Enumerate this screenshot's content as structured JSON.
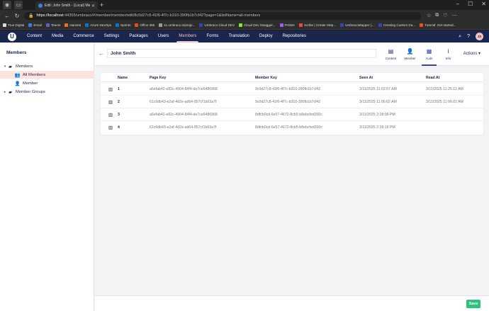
{
  "browser": {
    "tab_title": "Edit: John Smith - (Local) Member...",
    "new_tab": "+",
    "url_host": "https://localhost",
    "url_rest": ":44355/umbraco/#/member/member/edit/8c0d27c8-41f6-4f7c-b310-390fb1b7cf42?page=1&listName=all-members",
    "bookmarks": [
      {
        "label": "True Digital",
        "color": "#d9d9d9"
      },
      {
        "label": "Email",
        "color": "#3b7ddd"
      },
      {
        "label": "Teams",
        "color": "#5b5fc7"
      },
      {
        "label": "Harvest",
        "color": "#f36c21"
      },
      {
        "label": "Azure DevOps",
        "color": "#0078d4"
      },
      {
        "label": "Sprints",
        "color": "#0078d4"
      },
      {
        "label": "Office 365",
        "color": "#e74c1c"
      },
      {
        "label": "s1.umbraco.io/proje...",
        "color": "#999999"
      },
      {
        "label": "Umbraco Cloud DEV",
        "color": "#3544b1"
      },
      {
        "label": "Cloud Dev Swagger...",
        "color": "#85ea2d"
      },
      {
        "label": "FIGMA",
        "color": "#a259ff"
      },
      {
        "label": "Scribe | Create Step...",
        "color": "#e94b3c"
      },
      {
        "label": "UmbracoMapper |...",
        "color": "#3544b1"
      },
      {
        "label": "Creating Custom Da...",
        "color": "#3544b1"
      },
      {
        "label": "Tutorial: Get started...",
        "color": "#f25022"
      }
    ]
  },
  "topnav": {
    "logo": "U",
    "items": [
      "Content",
      "Media",
      "Commerce",
      "Settings",
      "Packages",
      "Users",
      "Members",
      "Forms",
      "Translation",
      "Deploy",
      "Repositories"
    ],
    "active_index": 6,
    "avatar": "JS"
  },
  "sidebar": {
    "title": "Members",
    "tree": [
      {
        "label": "Members",
        "caret": "▾",
        "icon": "▰"
      },
      {
        "label": "All Members",
        "caret": "",
        "icon": "👥"
      },
      {
        "label": "Member",
        "caret": "",
        "icon": "👤"
      },
      {
        "label": "Member Groups",
        "caret": "▸",
        "icon": "▰"
      }
    ]
  },
  "editor": {
    "name": "John Smith",
    "apps": [
      {
        "label": "Content",
        "icon": "▤"
      },
      {
        "label": "Member",
        "icon": "👤"
      },
      {
        "label": "Audit",
        "icon": "▦"
      },
      {
        "label": "Info",
        "icon": "i"
      }
    ],
    "active_app": 2,
    "actions_label": "Actions ▾"
  },
  "table": {
    "headers": [
      "Name",
      "Page Key",
      "Member Key",
      "Seen At",
      "Read At"
    ],
    "rows": [
      {
        "name": "1",
        "page_key": "a6efab42-e82c-4904-84f4-de7ce6486968",
        "member_key": "9c0d27c8-41f6-4f7c-b310-390fb1b7cf42",
        "seen_at": "3/11/2025 11:02:57 AM",
        "read_at": "3/11/2025 11:25:12 AM"
      },
      {
        "name": "2",
        "page_key": "61c6db43-e2af-4d2e-ad64-857cf1b63a7f",
        "member_key": "9c0d27c8-41f6-4f7c-b310-390fb1b7cf42",
        "seen_at": "3/11/2025 11:06:02 AM",
        "read_at": "3/11/2025 11:06:02 AM"
      },
      {
        "name": "3",
        "page_key": "a6efab42-e82c-4904-84f4-de7ce6486968",
        "member_key": "8dfcb0cd-6e57-4672-8cb5-b8ebcfed200c",
        "seen_at": "3/11/2025 2:28:08 PM",
        "read_at": ""
      },
      {
        "name": "4",
        "page_key": "61c6db43-e2af-4d2e-ad64-857cf1b63a7f",
        "member_key": "8dfcb0cd-6e57-4672-8cb5-b8ebcfed200c",
        "seen_at": "3/11/2025 2:28:19 PM",
        "read_at": ""
      }
    ]
  },
  "footer": {
    "save_label": "Save"
  },
  "colors": {
    "nav": "#1b264f",
    "accent": "#f5c1bc",
    "active_app": "#3544b1",
    "save": "#2bc37c"
  }
}
